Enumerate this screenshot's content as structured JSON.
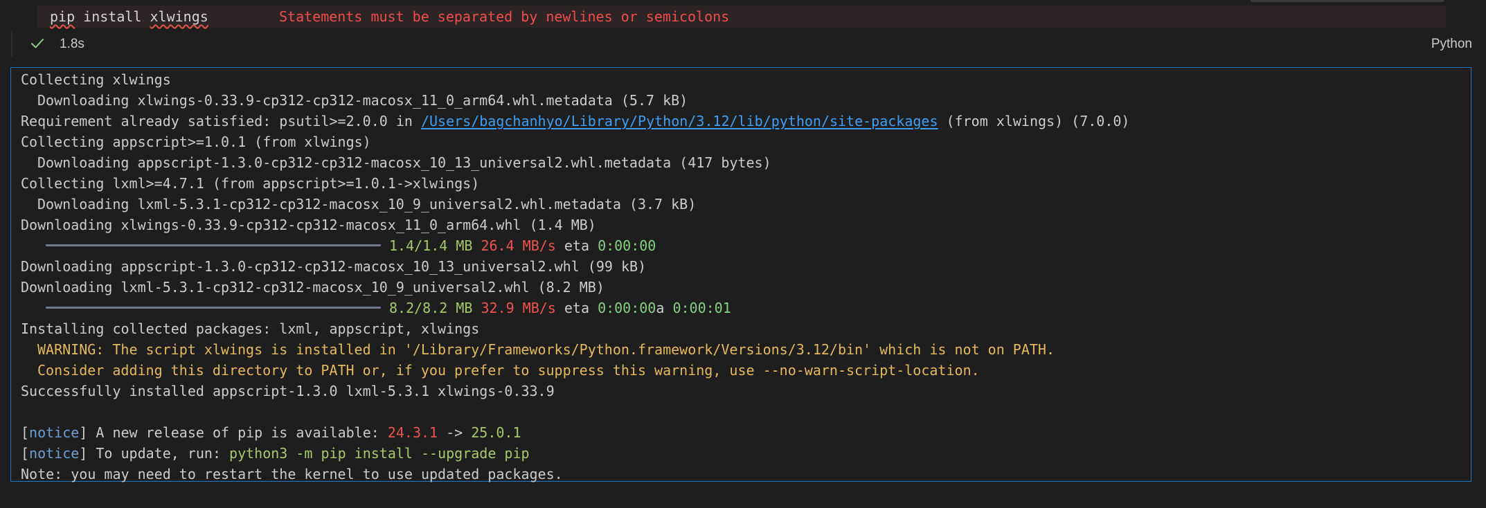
{
  "cell": {
    "code": "pip install xlwings",
    "code_error_word_1": "pip",
    "code_mid": "install",
    "code_error_word_2": "xlwings",
    "diagnostic": "Statements must be separated by newlines or semicolons",
    "status": {
      "duration": "1.8s",
      "language": "Python"
    }
  },
  "output": {
    "lines": [
      {
        "text": "Collecting xlwings"
      },
      {
        "text": "Downloading xlwings-0.33.9-cp312-cp312-macosx_11_0_arm64.whl.metadata (5.7 kB)"
      },
      {
        "before": "Requirement already satisfied: psutil>=2.0.0 in ",
        "link": "/Users/bagchanhyo/Library/Python/3.12/lib/python/site-packages",
        "after": " (from xlwings) (7.0.0)"
      },
      {
        "text": "Collecting appscript>=1.0.1 (from xlwings)"
      },
      {
        "text": "Downloading appscript-1.3.0-cp312-cp312-macosx_10_13_universal2.whl.metadata (417 bytes)"
      },
      {
        "text": "Collecting lxml>=4.7.1 (from appscript>=1.0.1->xlwings)"
      },
      {
        "text": "Downloading lxml-5.3.1-cp312-cp312-macosx_10_9_universal2.whl.metadata (3.7 kB)"
      },
      {
        "text": "Downloading xlwings-0.33.9-cp312-cp312-macosx_11_0_arm64.whl (1.4 MB)"
      },
      {
        "size": "1.4/1.4 MB",
        "speed": "26.4 MB/s",
        "eta_label": "eta",
        "eta": "0:00:00",
        "progress": 1.0
      },
      {
        "text": "Downloading appscript-1.3.0-cp312-cp312-macosx_10_13_universal2.whl (99 kB)"
      },
      {
        "text": "Downloading lxml-5.3.1-cp312-cp312-macosx_10_9_universal2.whl (8.2 MB)"
      },
      {
        "size": "8.2/8.2 MB",
        "speed": "32.9 MB/s",
        "eta_label": "eta",
        "eta": "0:00:00",
        "eta_suffix": "a",
        "eta2": "0:00:01",
        "progress": 1.0
      },
      {
        "text": "Installing collected packages: lxml, appscript, xlwings"
      },
      {
        "text": "WARNING: The script xlwings is installed in '/Library/Frameworks/Python.framework/Versions/3.12/bin' which is not on PATH."
      },
      {
        "text": "Consider adding this directory to PATH or, if you prefer to suppress this warning, use --no-warn-script-location."
      },
      {
        "text": "Successfully installed appscript-1.3.0 lxml-5.3.1 xlwings-0.33.9"
      },
      {
        "text": ""
      },
      {
        "bracket_open": "[",
        "tag": "notice",
        "bracket_close": "]",
        "text": " A new release of pip is available: ",
        "old_version": "24.3.1",
        "arrow": " -> ",
        "new_version": "25.0.1"
      },
      {
        "bracket_open": "[",
        "tag": "notice",
        "bracket_close": "]",
        "text": " To update, run: ",
        "command": "python3 -m pip install --upgrade pip"
      },
      {
        "text": "Note: you may need to restart the kernel to use updated packages."
      }
    ]
  },
  "colors": {
    "background": "#1e1e1e",
    "output_border": "#1f79c6",
    "error_text": "#f14c4c",
    "link": "#3d9ff5",
    "warning": "#e5b95c",
    "success_check": "#89d185"
  },
  "icons": {
    "status": "check-icon",
    "corner": "chevron-down-icon"
  }
}
